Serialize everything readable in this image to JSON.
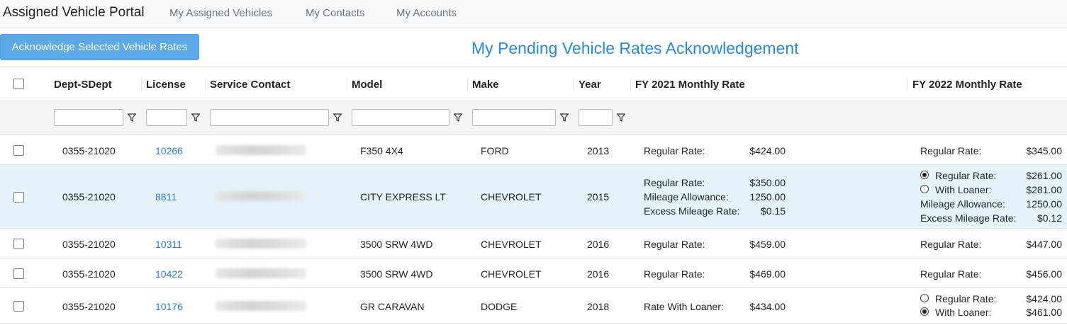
{
  "app": {
    "title": "Assigned Vehicle Portal",
    "nav": [
      "My Assigned Vehicles",
      "My Contacts",
      "My Accounts"
    ]
  },
  "toolbar": {
    "ack_label": "Acknowledge Selected Vehicle Rates"
  },
  "page": {
    "title": "My Pending Vehicle Rates Acknowledgement"
  },
  "colors": {
    "accent": "#2b8ad8",
    "button": "#5ba9e8",
    "highlight_row": "#e6f3fb",
    "link": "#2b7bd1"
  },
  "icons": {
    "filter": "filter-icon",
    "checkbox": "checkbox",
    "radio": "radio-button"
  },
  "table": {
    "headers": [
      "Dept-SDept",
      "License",
      "Service Contact",
      "Model",
      "Make",
      "Year",
      "FY 2021 Monthly Rate",
      "FY 2022 Monthly Rate"
    ],
    "rows": [
      {
        "dept": "0355-21020",
        "license": "10266",
        "model": "F350 4X4",
        "make": "FORD",
        "year": "2013",
        "fy21": [
          {
            "label": "Regular Rate:",
            "value": "$424.00"
          }
        ],
        "fy22": [
          {
            "label": "Regular Rate:",
            "value": "$345.00"
          }
        ]
      },
      {
        "dept": "0355-21020",
        "license": "8811",
        "model": "CITY EXPRESS LT",
        "make": "CHEVROLET",
        "year": "2015",
        "fy21": [
          {
            "label": "Regular Rate:",
            "value": "$350.00"
          },
          {
            "label": "Mileage Allowance:",
            "value": "1250.00"
          },
          {
            "label": "Excess Mileage Rate:",
            "value": "$0.15"
          }
        ],
        "fy22": [
          {
            "label": "Regular Rate:",
            "value": "$261.00",
            "radio": true,
            "selected": true
          },
          {
            "label": "With Loaner:",
            "value": "$281.00",
            "radio": true,
            "selected": false
          },
          {
            "label": "Mileage Allowance:",
            "value": "1250.00"
          },
          {
            "label": "Excess Mileage Rate:",
            "value": "$0.12"
          }
        ]
      },
      {
        "dept": "0355-21020",
        "license": "10311",
        "model": "3500 SRW 4WD",
        "make": "CHEVROLET",
        "year": "2016",
        "fy21": [
          {
            "label": "Regular Rate:",
            "value": "$459.00"
          }
        ],
        "fy22": [
          {
            "label": "Regular Rate:",
            "value": "$447.00"
          }
        ]
      },
      {
        "dept": "0355-21020",
        "license": "10422",
        "model": "3500 SRW 4WD",
        "make": "CHEVROLET",
        "year": "2016",
        "fy21": [
          {
            "label": "Regular Rate:",
            "value": "$469.00"
          }
        ],
        "fy22": [
          {
            "label": "Regular Rate:",
            "value": "$456.00"
          }
        ]
      },
      {
        "dept": "0355-21020",
        "license": "10176",
        "model": "GR CARAVAN",
        "make": "DODGE",
        "year": "2018",
        "fy21": [
          {
            "label": "Rate With Loaner:",
            "value": "$434.00"
          }
        ],
        "fy22": [
          {
            "label": "Regular Rate:",
            "value": "$424.00",
            "radio": true,
            "selected": false
          },
          {
            "label": "With Loaner:",
            "value": "$461.00",
            "radio": true,
            "selected": true
          }
        ]
      }
    ]
  }
}
